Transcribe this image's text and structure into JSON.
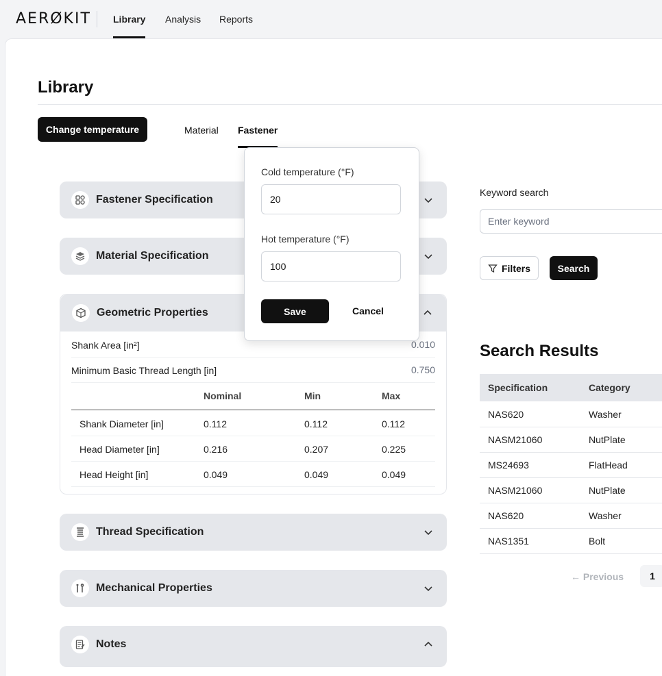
{
  "nav": {
    "logo": "AERØKIT",
    "items": [
      {
        "label": "Library"
      },
      {
        "label": "Analysis"
      },
      {
        "label": "Reports"
      }
    ]
  },
  "page": {
    "title": "Library",
    "change_temp_label": "Change temperature",
    "tabs": [
      {
        "label": "Material"
      },
      {
        "label": "Fastener"
      }
    ]
  },
  "accordions": [
    {
      "title": "Fastener Specification",
      "icon": "fastener-icon",
      "expanded": false
    },
    {
      "title": "Material Specification",
      "icon": "layers-icon",
      "expanded": false
    },
    {
      "title": "Geometric Properties",
      "icon": "cube-icon",
      "expanded": true
    },
    {
      "title": "Thread Specification",
      "icon": "thread-icon",
      "expanded": false
    },
    {
      "title": "Mechanical Properties",
      "icon": "tools-icon",
      "expanded": false
    },
    {
      "title": "Notes",
      "icon": "notes-icon",
      "expanded": true
    }
  ],
  "geometric": {
    "kv": [
      {
        "label": "Shank Area [in²]",
        "value": "0.010"
      },
      {
        "label": "Minimum Basic Thread Length [in]",
        "value": "0.750"
      }
    ],
    "columns": [
      "Nominal",
      "Min",
      "Max"
    ],
    "rows": [
      {
        "label": "Shank Diameter [in]",
        "nominal": "0.112",
        "min": "0.112",
        "max": "0.112"
      },
      {
        "label": "Head Diameter [in]",
        "nominal": "0.216",
        "min": "0.207",
        "max": "0.225"
      },
      {
        "label": "Head Height [in]",
        "nominal": "0.049",
        "min": "0.049",
        "max": "0.049"
      }
    ]
  },
  "popover": {
    "cold_label": "Cold temperature (°F)",
    "cold_value": "20",
    "hot_label": "Hot temperature (°F)",
    "hot_value": "100",
    "save_label": "Save",
    "cancel_label": "Cancel"
  },
  "search": {
    "keyword_label": "Keyword search",
    "placeholder": "Enter keyword",
    "filters_label": "Filters",
    "search_label": "Search"
  },
  "results": {
    "title": "Search Results",
    "columns": [
      "Specification",
      "Category"
    ],
    "rows": [
      {
        "spec": "NAS620",
        "category": "Washer"
      },
      {
        "spec": "NASM21060",
        "category": "NutPlate"
      },
      {
        "spec": "MS24693",
        "category": "FlatHead"
      },
      {
        "spec": "NASM21060",
        "category": "NutPlate"
      },
      {
        "spec": "NAS620",
        "category": "Washer"
      },
      {
        "spec": "NAS1351",
        "category": "Bolt"
      }
    ],
    "pagination": {
      "previous_label": "← Previous",
      "current_page": "1"
    }
  }
}
